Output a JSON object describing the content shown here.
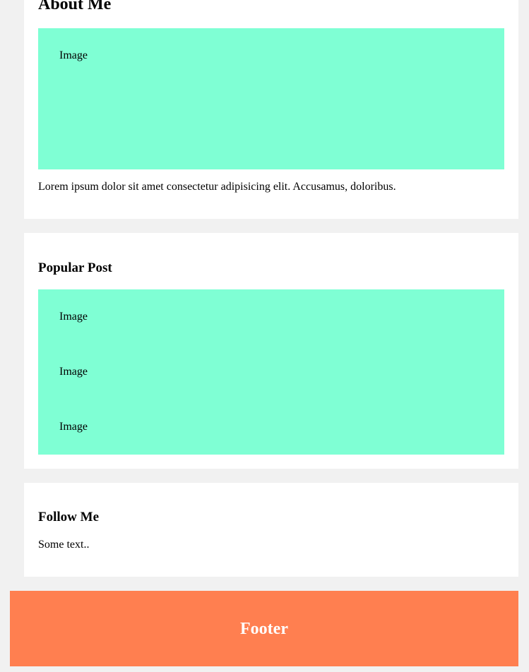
{
  "about": {
    "title": "About Me",
    "image_label": "Image",
    "text": "Lorem ipsum dolor sit amet consectetur adipisicing elit. Accusamus, doloribus."
  },
  "popular": {
    "title": "Popular Post",
    "images": [
      {
        "label": "Image"
      },
      {
        "label": "Image"
      },
      {
        "label": "Image"
      }
    ]
  },
  "follow": {
    "title": "Follow Me",
    "text": "Some text.."
  },
  "footer": {
    "title": "Footer"
  },
  "colors": {
    "page_background": "#f1f1f1",
    "card_background": "#ffffff",
    "image_placeholder": "#7fffd4",
    "footer_background": "#ff7f50",
    "footer_text": "#ffffff"
  }
}
